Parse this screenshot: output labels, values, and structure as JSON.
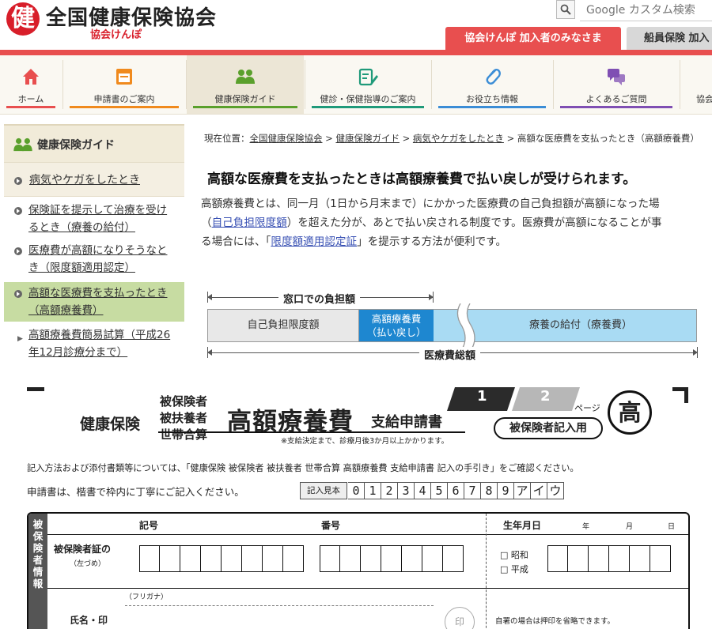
{
  "header": {
    "logo_mark": "健",
    "title": "全国健康保険協会",
    "subtitle": "協会けんぽ",
    "search_placeholder": "Google カスタム検索",
    "tab_members": "協会けんぽ 加入者のみなさま",
    "tab_seamen": "船員保険 加入"
  },
  "nav": [
    {
      "label": "ホーム",
      "icon": "home-icon",
      "color": "#e84f4f"
    },
    {
      "label": "申請書のご案内",
      "icon": "form-window-icon",
      "color": "#f08a1d"
    },
    {
      "label": "健康保険ガイド",
      "icon": "people-icon",
      "color": "#5aa02c"
    },
    {
      "label": "健診・保健指導のご案内",
      "icon": "clipboard-pen-icon",
      "color": "#1f9a7a"
    },
    {
      "label": "お役立ち情報",
      "icon": "paperclip-icon",
      "color": "#3b8dd6"
    },
    {
      "label": "よくあるご質問",
      "icon": "chat-bubble-icon",
      "color": "#7f4fb3"
    },
    {
      "label": "協会",
      "icon": "",
      "color": "#c05050"
    }
  ],
  "sidebar": {
    "title": "健康保険ガイド",
    "items": [
      {
        "label": "病気やケガをしたとき"
      },
      {
        "label_1": "保険証を提示して治療を受け",
        "label_2": "るとき（療養の給付）"
      },
      {
        "label_1": "医療費が高額になりそうなと",
        "label_2": "き（限度額適用認定）"
      },
      {
        "label_1": "高額な医療費を支払ったとき",
        "label_2": "（高額療養費）"
      },
      {
        "label_1": "高額療養費簡易試算（平成26",
        "label_2": "年12月診療分まで）"
      }
    ]
  },
  "breadcrumb": {
    "prefix": "現在位置：",
    "items": [
      "全国健康保険協会",
      "健康保険ガイド",
      "病気やケガをしたとき"
    ],
    "sep": ">",
    "current": "高額な医療費を支払ったとき（高額療養費）"
  },
  "main": {
    "heading": "高額な医療費を支払ったときは高額療養費で払い戻しが受けられます。",
    "para_1": "高額療養費とは、同一月（1日から月末まで）にかかった医療費の自己負担額が高額になった場",
    "para_2a": "（",
    "para_2_link": "自己負担限度額",
    "para_2b": "）を超えた分が、あとで払い戻される制度です。医療費が高額になることが事",
    "para_3a": "る場合には、「",
    "para_3_link": "限度額適用認定証",
    "para_3b": "」を提示する方法が便利です。"
  },
  "diagram": {
    "top_label": "窓口での負担額",
    "seg_1": "自己負担限度額",
    "seg_2_line1": "高額療養費",
    "seg_2_line2": "（払い戻し）",
    "seg_3": "療養の給付（療養費）",
    "bottom_label": "医療費総額"
  },
  "form": {
    "insurance": "健康保険",
    "who_1": "被保険者",
    "who_2": "被扶養者",
    "who_3": "世帯合算",
    "title": "高額療養費",
    "title_suffix": "支給申請書",
    "note": "※支給決定まで、診療月後3か月以上かかります。",
    "page_1": "1",
    "page_2": "2",
    "page_label": "ページ",
    "for_insured": "被保険者記入用",
    "seal_char": "高",
    "instr_1": "記入方法および添付書類等については、「健康保険 被保険者 被扶養者 世帯合算 高額療養費 支給申請書 記入の手引き」をご確認ください。",
    "instr_2": "申請書は、楷書で枠内に丁寧にご記入ください。",
    "sample_label": "記入見本",
    "sample_chars": [
      "0",
      "1",
      "2",
      "3",
      "4",
      "5",
      "6",
      "7",
      "8",
      "9",
      "ア",
      "イ",
      "ウ"
    ],
    "side_label": [
      "被",
      "保",
      "険",
      "者",
      "情",
      "報"
    ],
    "col_kigo": "記号",
    "col_bango": "番号",
    "col_birth": "生年月日",
    "col_year": "年",
    "col_month": "月",
    "col_day": "日",
    "row_card_1": "被保険者証の",
    "row_card_2": "（左づめ）",
    "era_1": "□ 昭和",
    "era_2": "□ 平成",
    "furigana": "（フリガナ）",
    "row_name": "氏名・印",
    "seal_mark": "印",
    "sign_note": "自署の場合は押印を省略できます。"
  }
}
